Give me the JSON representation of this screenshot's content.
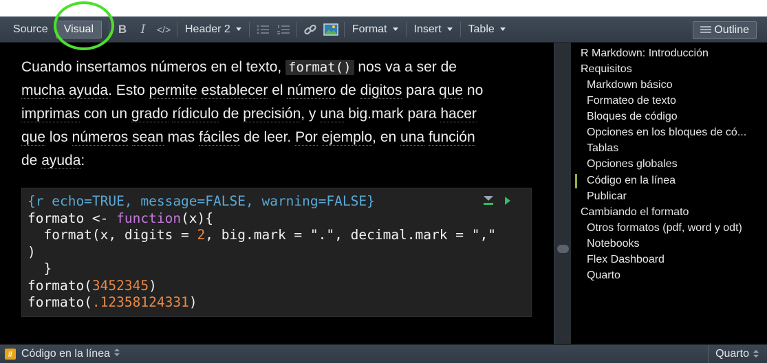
{
  "toolbar": {
    "source_label": "Source",
    "visual_label": "Visual",
    "bold_glyph": "B",
    "italic_glyph": "I",
    "code_glyph": "</>",
    "header_label": "Header 2",
    "format_label": "Format",
    "insert_label": "Insert",
    "table_label": "Table",
    "outline_label": "Outline"
  },
  "content": {
    "p1": "Cuando insertamos números en el texto, ",
    "code_format": "format()",
    "p2": " nos va a ser de",
    "w_mucha": "mucha",
    "w_ayuda": "ayuda",
    "dot1": ". Esto ",
    "w_permite": "permite",
    "sp1": " ",
    "w_establecer": "establecer",
    "el1": " el ",
    "w_numero": "número",
    "de1": " de ",
    "w_digitos": "digitos",
    "para1": " para ",
    "w_que1": "que",
    "no1": " no",
    "w_imprimas": "imprimas",
    "con1": " con un ",
    "w_grado": "grado",
    "sp2": " ",
    "w_ridiculo": "rídiculo",
    "de2": " de ",
    "w_precision": "precisión",
    "comma_y": ", y ",
    "w_una": "una",
    "bigmark": " big.mark para ",
    "w_hacer": "hacer",
    "w_que2": "que",
    "los1": " los ",
    "w_numeros": "números",
    "sp3": " ",
    "w_sean": "sean",
    "mas": " mas ",
    "w_faciles": "fáciles",
    "deleer": " de leer. ",
    "w_por": "Por",
    "sp4": " ",
    "w_ejemplo": "ejemplo",
    "comma_en": ", en ",
    "w_una2": "una",
    "sp5": " ",
    "w_funcion": "función",
    "de3": "de ",
    "w_ayuda2": "ayuda",
    "colon": ":"
  },
  "code": {
    "header": "{r echo=TRUE, message=FALSE, warning=FALSE}",
    "l2_a": "formato <- ",
    "l2_kw": "function",
    "l2_b": "(x){",
    "l3_a": "  format(x, digits = ",
    "l3_num": "2",
    "l3_b": ", big.mark = \".\", decimal.mark = \",\"",
    "l4": ")",
    "l5": "  }",
    "l6_a": "formato(",
    "l6_num": "3452345",
    "l6_b": ")",
    "l7_a": "formato(",
    "l7_num": ".12358124331",
    "l7_b": ")"
  },
  "outline": {
    "items": [
      {
        "label": "R Markdown: Introducción"
      },
      {
        "label": "Requisitos"
      },
      {
        "label": "Markdown básico"
      },
      {
        "label": "Formateo de texto"
      },
      {
        "label": "Bloques de código"
      },
      {
        "label": "Opciones en los bloques de có..."
      },
      {
        "label": "Tablas"
      },
      {
        "label": "Opciones globales"
      },
      {
        "label": "Código en la línea"
      },
      {
        "label": "Publicar"
      },
      {
        "label": "Cambiando el formato"
      },
      {
        "label": "Otros formatos (pdf, word y odt)"
      },
      {
        "label": "Notebooks"
      },
      {
        "label": "Flex Dashboard"
      },
      {
        "label": "Quarto"
      }
    ]
  },
  "status": {
    "badge": "#",
    "section": "Código en la línea",
    "doc_type": "Quarto"
  },
  "colors": {
    "highlight_circle": "#4ce02c",
    "chunk_header": "#5ba8d6",
    "keyword": "#c678dd",
    "number": "#e8894a",
    "run_button": "#2fbf5f",
    "badge": "#e8a317"
  }
}
